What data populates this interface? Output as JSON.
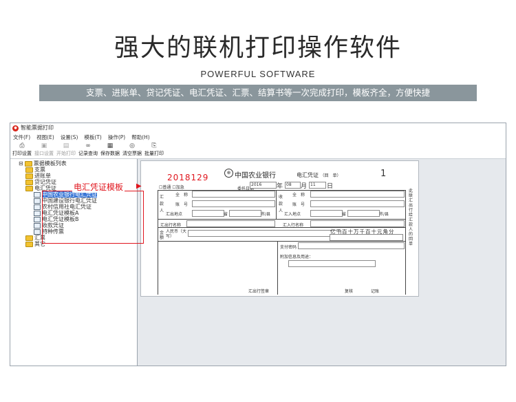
{
  "hero": {
    "title": "强大的联机打印操作软件",
    "subtitle": "POWERFUL SOFTWARE",
    "banner": "支票、进账单、贷记凭证、电汇凭证、汇票、结算书等一次完成打印，模板齐全，方便快捷"
  },
  "window": {
    "title": "智能票据打印",
    "menu": [
      "文件(F)",
      "视图(E)",
      "设置(S)",
      "模板(T)",
      "操作(P)",
      "帮助(H)"
    ],
    "toolbar": [
      {
        "label": "打印设置",
        "icon": "printer-settings-icon",
        "enabled": true
      },
      {
        "label": "接口设置",
        "icon": "interface-settings-icon",
        "enabled": false
      },
      {
        "label": "开始打印",
        "icon": "print-start-icon",
        "enabled": false
      },
      {
        "label": "记录查询",
        "icon": "binoculars-icon",
        "enabled": true
      },
      {
        "label": "保存数据",
        "icon": "save-icon",
        "enabled": true
      },
      {
        "label": "清空票据",
        "icon": "clear-icon",
        "enabled": true
      },
      {
        "label": "批量打印",
        "icon": "batch-print-icon",
        "enabled": true
      }
    ]
  },
  "tree": {
    "root": "票据模板列表",
    "folders_top": [
      "支票",
      "进账单",
      "贷记凭证",
      "电汇凭证"
    ],
    "children": [
      "中国农业银行电汇凭证",
      "中国建设银行电汇凭证",
      "农村信用社电汇凭证",
      "电汇凭证模板A",
      "电汇凭证模板B",
      "收款凭证",
      "特种传票"
    ],
    "selected_index": 0,
    "folders_bottom": [
      "汇票",
      "其它"
    ]
  },
  "annotation": {
    "label": "电汇凭证模板",
    "arrow": "▶"
  },
  "voucher": {
    "seq_no": "2018129",
    "bank": "中国农业银行",
    "type": "电汇凭证",
    "type_note": "（回　单）",
    "page_no": "1",
    "opt1": "普通",
    "opt2": "加急",
    "date_label": "委托日期",
    "year": "2016",
    "month": "08",
    "day": "11",
    "year_unit": "年",
    "month_unit": "月",
    "day_unit": "日",
    "payer": [
      "全　称",
      "账　号",
      "汇出地点"
    ],
    "payee": [
      "全　称",
      "账　号",
      "汇入地点"
    ],
    "payer_side": "汇款人",
    "payee_side": "收款人",
    "payer_bank": "汇出行名称",
    "payee_bank": "汇入行名称",
    "province": "省",
    "city": "市/县",
    "amount_label": "金额",
    "amount_cn": "人民币（大写）",
    "digits": "亿千百十万千百十元角分",
    "pay_pwd": "支付密码",
    "extra": "附加信息及用途：",
    "sig_left": "汇出行签章",
    "sig_r1": "复核",
    "sig_r2": "记账",
    "side_text": "此联汇出行给汇款人的回单"
  }
}
